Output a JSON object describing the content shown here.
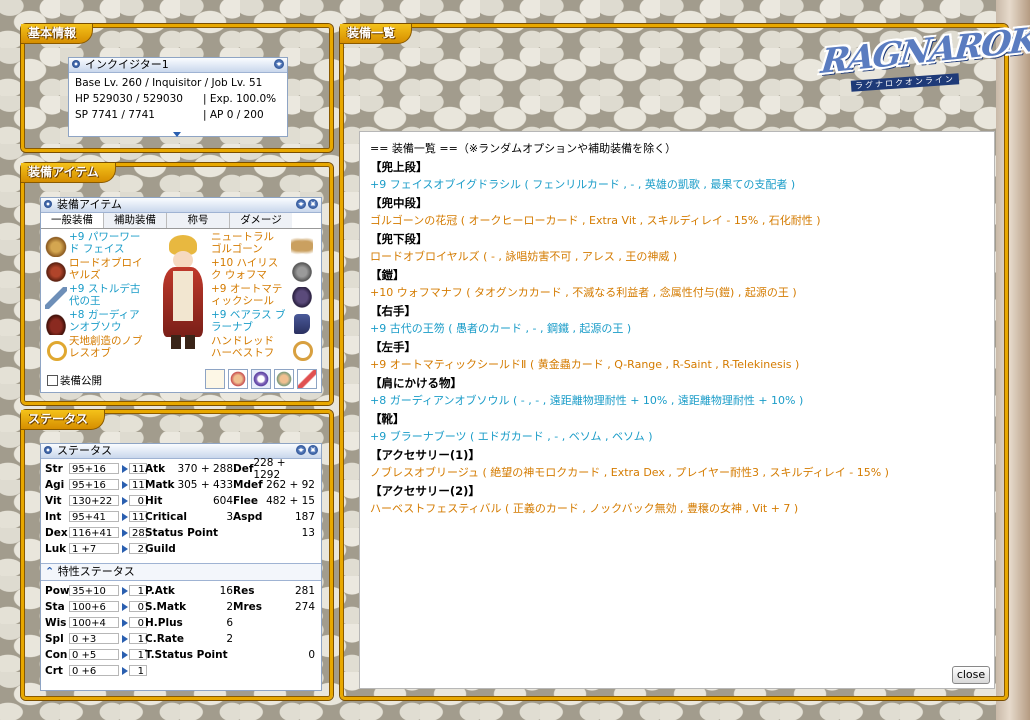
{
  "colors": {
    "frame": "#e8a800",
    "cyan": "#1a9cc8",
    "orange": "#d47b00",
    "win_border": "#8ea4c4"
  },
  "basic": {
    "tab": "基本情報",
    "win_title": "インクイジター1",
    "line1": "Base Lv. 260 / Inquisitor / Job Lv. 51",
    "hp": "HP 529030 / 529030",
    "exp": "| Exp. 100.0%",
    "sp": "SP 7741 / 7741",
    "ap": "| AP 0 / 200"
  },
  "equip_panel": {
    "tab": "装備アイテム",
    "win_title": "装備アイテム",
    "tabs": [
      "一般装備",
      "補助装備",
      "称号",
      "ダメージ"
    ],
    "left_items": [
      {
        "text": "+9 パワーワード フェイス",
        "color": "cyan",
        "icon": "head-icon"
      },
      {
        "text": "ロードオブロイヤルズ",
        "color": "orange",
        "icon": "mask-icon"
      },
      {
        "text": "+9 ストルデ古代の王",
        "color": "cyan",
        "icon": "wand-icon"
      },
      {
        "text": "+8 ガーディアンオブソウ",
        "color": "cyan",
        "icon": "garment-icon"
      },
      {
        "text": "天地創造のノブレスオブ",
        "color": "orange",
        "icon": "ring-icon"
      }
    ],
    "right_items": [
      {
        "text": "ニュートラル ゴルゴーン",
        "color": "orange",
        "icon": "wings-icon"
      },
      {
        "text": "+10 ハイリスク ウォフマ",
        "color": "orange",
        "icon": "armor-icon"
      },
      {
        "text": "+9 オートマティックシール",
        "color": "orange",
        "icon": "shield-icon"
      },
      {
        "text": "+9 ベアラス ブラーナブ",
        "color": "cyan",
        "icon": "boots-icon"
      },
      {
        "text": "ハンドレッド ハーベストフ",
        "color": "orange",
        "icon": "ring-icon"
      }
    ],
    "checkbox_label": "装備公開"
  },
  "status_panel": {
    "tab": "ステータス",
    "win_title": "ステータス",
    "stats": [
      {
        "name": "Str",
        "val": "95+16",
        "bonus": "11"
      },
      {
        "name": "Agi",
        "val": "95+16",
        "bonus": "11"
      },
      {
        "name": "Vit",
        "val": "130+22",
        "bonus": "0"
      },
      {
        "name": "Int",
        "val": "95+41",
        "bonus": "11"
      },
      {
        "name": "Dex",
        "val": "116+41",
        "bonus": "28"
      },
      {
        "name": "Luk",
        "val": "1 +7",
        "bonus": "2"
      }
    ],
    "mid": [
      {
        "label": "Atk",
        "value": "370 + 288"
      },
      {
        "label": "Matk",
        "value": "305 + 433"
      },
      {
        "label": "Hit",
        "value": "604"
      },
      {
        "label": "Critical",
        "value": "3"
      },
      {
        "label": "Status Point",
        "value": "13"
      },
      {
        "label": "Guild",
        "value": ""
      }
    ],
    "right": [
      {
        "label": "Def",
        "value": "228 + 1292"
      },
      {
        "label": "Mdef",
        "value": "262 + 92"
      },
      {
        "label": "Flee",
        "value": "482 + 15"
      },
      {
        "label": "Aspd",
        "value": "187"
      }
    ],
    "trait_title": "特性ステータス",
    "traits": [
      {
        "name": "Pow",
        "val": "35+10",
        "bonus": "1"
      },
      {
        "name": "Sta",
        "val": "100+6",
        "bonus": "0"
      },
      {
        "name": "Wis",
        "val": "100+4",
        "bonus": "0"
      },
      {
        "name": "Spl",
        "val": "0 +3",
        "bonus": "1"
      },
      {
        "name": "Con",
        "val": "0 +5",
        "bonus": "1"
      },
      {
        "name": "Crt",
        "val": "0 +6",
        "bonus": "1"
      }
    ],
    "trait_mid": [
      {
        "label": "P.Atk",
        "value": "16"
      },
      {
        "label": "S.Matk",
        "value": "2"
      },
      {
        "label": "H.Plus",
        "value": "6"
      },
      {
        "label": "C.Rate",
        "value": "2"
      },
      {
        "label": "T.Status Point",
        "value": "0"
      }
    ],
    "trait_right": [
      {
        "label": "Res",
        "value": "281"
      },
      {
        "label": "Mres",
        "value": "274"
      }
    ]
  },
  "list_panel": {
    "tab": "装備一覧",
    "header": "== 装備一覧 ==（※ランダムオプションや補助装備を除く）",
    "sections": [
      {
        "title": "【兜上段】",
        "item": "+9 フェイスオブイグドラシル ( フェンリルカード , - , 英雄の凱歌 , 最果ての支配者 )",
        "color": "cyan"
      },
      {
        "title": "【兜中段】",
        "item": "ゴルゴーンの花冠 ( オークヒーローカード , Extra Vit , スキルディレイ - 15% , 石化耐性 )",
        "color": "orange"
      },
      {
        "title": "【兜下段】",
        "item": "ロードオブロイヤルズ ( - , 詠唱妨害不可 , アレス , 王の神威 )",
        "color": "orange"
      },
      {
        "title": "【鎧】",
        "item": "+10 ウォフマナフ ( タオグンカカード , 不滅なる利益者 , 念属性付与(鎧) , 起源の王 )",
        "color": "orange"
      },
      {
        "title": "【右手】",
        "item": "+9 古代の王笏 ( 愚者のカード , - , 鋼鐵 , 起源の王 )",
        "color": "cyan"
      },
      {
        "title": "【左手】",
        "item": "+9 オートマティックシールドⅡ ( 黄金蟲カード , Q-Range , R-Saint , R-Telekinesis )",
        "color": "orange"
      },
      {
        "title": "【肩にかける物】",
        "item": "+8 ガーディアンオブソウル ( - , - , 遠距離物理耐性 + 10% , 遠距離物理耐性 + 10% )",
        "color": "cyan"
      },
      {
        "title": "【靴】",
        "item": "+9 ブラーナブーツ ( エドガカード , - , ベソム , ベソム )",
        "color": "cyan"
      },
      {
        "title": "【アクセサリー(1)】",
        "item": "ノブレスオブリージュ ( 絶望の神モロクカード , Extra Dex , プレイヤー耐性3 , スキルディレイ - 15% )",
        "color": "orange"
      },
      {
        "title": "【アクセサリー(2)】",
        "item": "ハーベストフェスティバル ( 正義のカード , ノックバック無効 , 豊穣の女神 , Vit + 7 )",
        "color": "orange"
      }
    ],
    "close_label": "close"
  },
  "logo": {
    "text": "RAGNAROK",
    "sub": "ラグナロクオンライン"
  }
}
